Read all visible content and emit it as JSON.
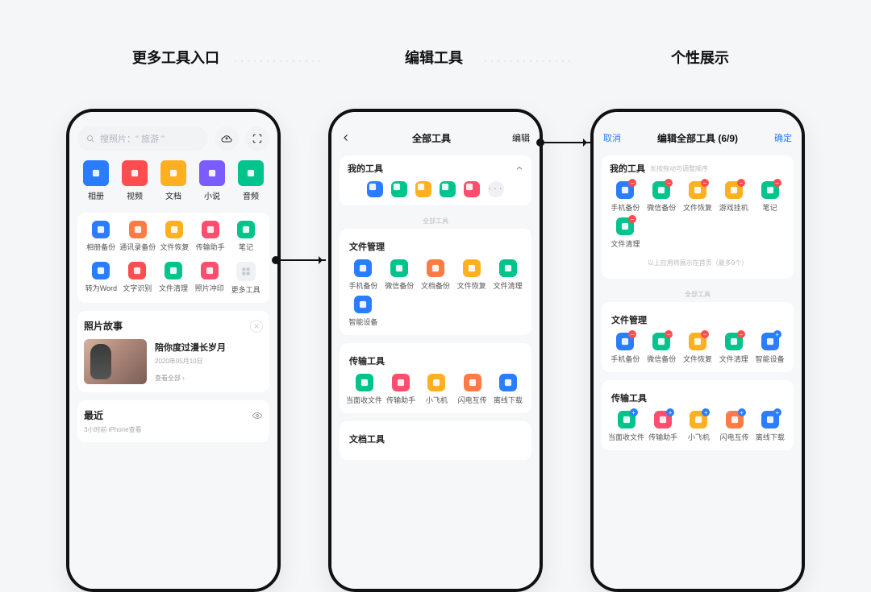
{
  "headings": {
    "h1": "更多工具入口",
    "h2": "编辑工具",
    "h3": "个性展示"
  },
  "phone1": {
    "search_placeholder": "搜照片：\" 旅游 \"",
    "topTabs": [
      {
        "label": "相册",
        "color": "#2a7dff"
      },
      {
        "label": "视频",
        "color": "#ff4d4f"
      },
      {
        "label": "文档",
        "color": "#ffb020"
      },
      {
        "label": "小说",
        "color": "#7a5cff"
      },
      {
        "label": "音频",
        "color": "#00c48c"
      }
    ],
    "toolsA": [
      {
        "label": "相册备份",
        "color": "#2a7dff"
      },
      {
        "label": "通讯录备份",
        "color": "#ff7a45"
      },
      {
        "label": "文件恢复",
        "color": "#ffb020"
      },
      {
        "label": "传输助手",
        "color": "#ff4d6d"
      },
      {
        "label": "笔记",
        "color": "#00c48c"
      }
    ],
    "toolsB": [
      {
        "label": "转为Word",
        "color": "#2a7dff"
      },
      {
        "label": "文字识别",
        "color": "#ff4d4f"
      },
      {
        "label": "文件清理",
        "color": "#00c48c"
      },
      {
        "label": "照片冲印",
        "color": "#ff4d6d"
      },
      {
        "label": "更多工具",
        "color": "#d0d3d9"
      }
    ],
    "story": {
      "section": "照片故事",
      "title": "陪你度过漫长岁月",
      "date": "2020年05月10日",
      "viewAll": "查看全部"
    },
    "recent": {
      "section": "最近",
      "sub": "3小时前 iPhone查看"
    }
  },
  "phone2": {
    "title": "全部工具",
    "action": "编辑",
    "myTools": "我的工具",
    "allTools": "全部工具",
    "groups": [
      {
        "name": "文件管理",
        "items": [
          {
            "label": "手机备份",
            "color": "#2a7dff"
          },
          {
            "label": "微信备份",
            "color": "#00c48c"
          },
          {
            "label": "文档备份",
            "color": "#ff7a45"
          },
          {
            "label": "文件恢复",
            "color": "#ffb020"
          },
          {
            "label": "文件清理",
            "color": "#00c48c"
          },
          {
            "label": "智能设备",
            "color": "#2a7dff"
          }
        ]
      },
      {
        "name": "传输工具",
        "items": [
          {
            "label": "当面收文件",
            "color": "#00c48c"
          },
          {
            "label": "传输助手",
            "color": "#ff4d6d"
          },
          {
            "label": "小飞机",
            "color": "#ffb020"
          },
          {
            "label": "闪电互传",
            "color": "#ff7a45"
          },
          {
            "label": "离线下载",
            "color": "#2a7dff"
          }
        ]
      },
      {
        "name": "文档工具",
        "items": []
      }
    ],
    "myToolsRow": [
      {
        "color": "#2a7dff"
      },
      {
        "color": "#00c48c"
      },
      {
        "color": "#ffb020"
      },
      {
        "color": "#00c48c"
      },
      {
        "color": "#ff4d6d"
      }
    ]
  },
  "phone3": {
    "cancel": "取消",
    "title": "编辑全部工具 (6/9)",
    "confirm": "确定",
    "myTools": "我的工具",
    "dragHint": "长按拖动可调整顺序",
    "limitHint": "以上应用将展示在首页（最多9个）",
    "allTools": "全部工具",
    "myItems": [
      {
        "label": "手机备份",
        "color": "#2a7dff"
      },
      {
        "label": "微信备份",
        "color": "#00c48c"
      },
      {
        "label": "文件恢复",
        "color": "#ffb020"
      },
      {
        "label": "游戏挂机",
        "color": "#ffb020"
      },
      {
        "label": "笔记",
        "color": "#00c48c"
      },
      {
        "label": "文件清理",
        "color": "#00c48c"
      }
    ],
    "groups": [
      {
        "name": "文件管理",
        "items": [
          {
            "label": "手机备份",
            "color": "#2a7dff",
            "badge": "minus"
          },
          {
            "label": "微信备份",
            "color": "#00c48c",
            "badge": "minus"
          },
          {
            "label": "文件恢复",
            "color": "#ffb020",
            "badge": "minus"
          },
          {
            "label": "文件清理",
            "color": "#00c48c",
            "badge": "minus"
          },
          {
            "label": "智能设备",
            "color": "#2a7dff",
            "badge": "plus"
          }
        ]
      },
      {
        "name": "传输工具",
        "items": [
          {
            "label": "当面收文件",
            "color": "#00c48c",
            "badge": "plus"
          },
          {
            "label": "传输助手",
            "color": "#ff4d6d",
            "badge": "plus"
          },
          {
            "label": "小飞机",
            "color": "#ffb020",
            "badge": "plus"
          },
          {
            "label": "闪电互传",
            "color": "#ff7a45",
            "badge": "plus"
          },
          {
            "label": "离线下载",
            "color": "#2a7dff",
            "badge": "plus"
          }
        ]
      }
    ]
  }
}
